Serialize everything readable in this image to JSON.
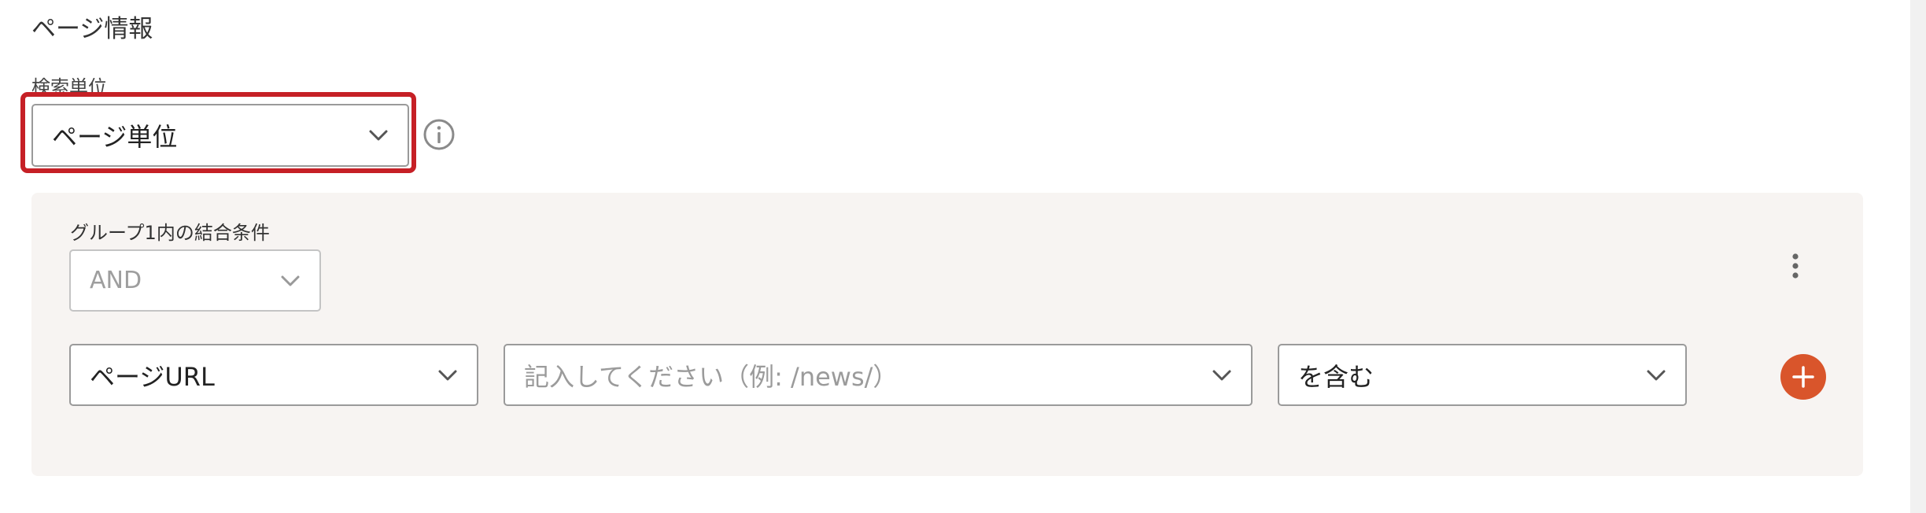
{
  "page": {
    "section_title": "ページ情報",
    "search_unit": {
      "label": "検索単位",
      "value": "ページ単位"
    },
    "group": {
      "condition_label": "グループ1内の結合条件",
      "condition_value": "AND",
      "filter": {
        "field_value": "ページURL",
        "input_placeholder": "記入してください（例: /news/）",
        "operator_value": "を含む"
      }
    }
  },
  "icons": {
    "info": "info-circle-icon",
    "chevron": "chevron-down-icon",
    "more": "vertical-dots-icon",
    "add": "plus-icon"
  },
  "colors": {
    "highlight": "#c62026",
    "accent": "#d9552b",
    "panel_bg": "#f7f4f2"
  }
}
